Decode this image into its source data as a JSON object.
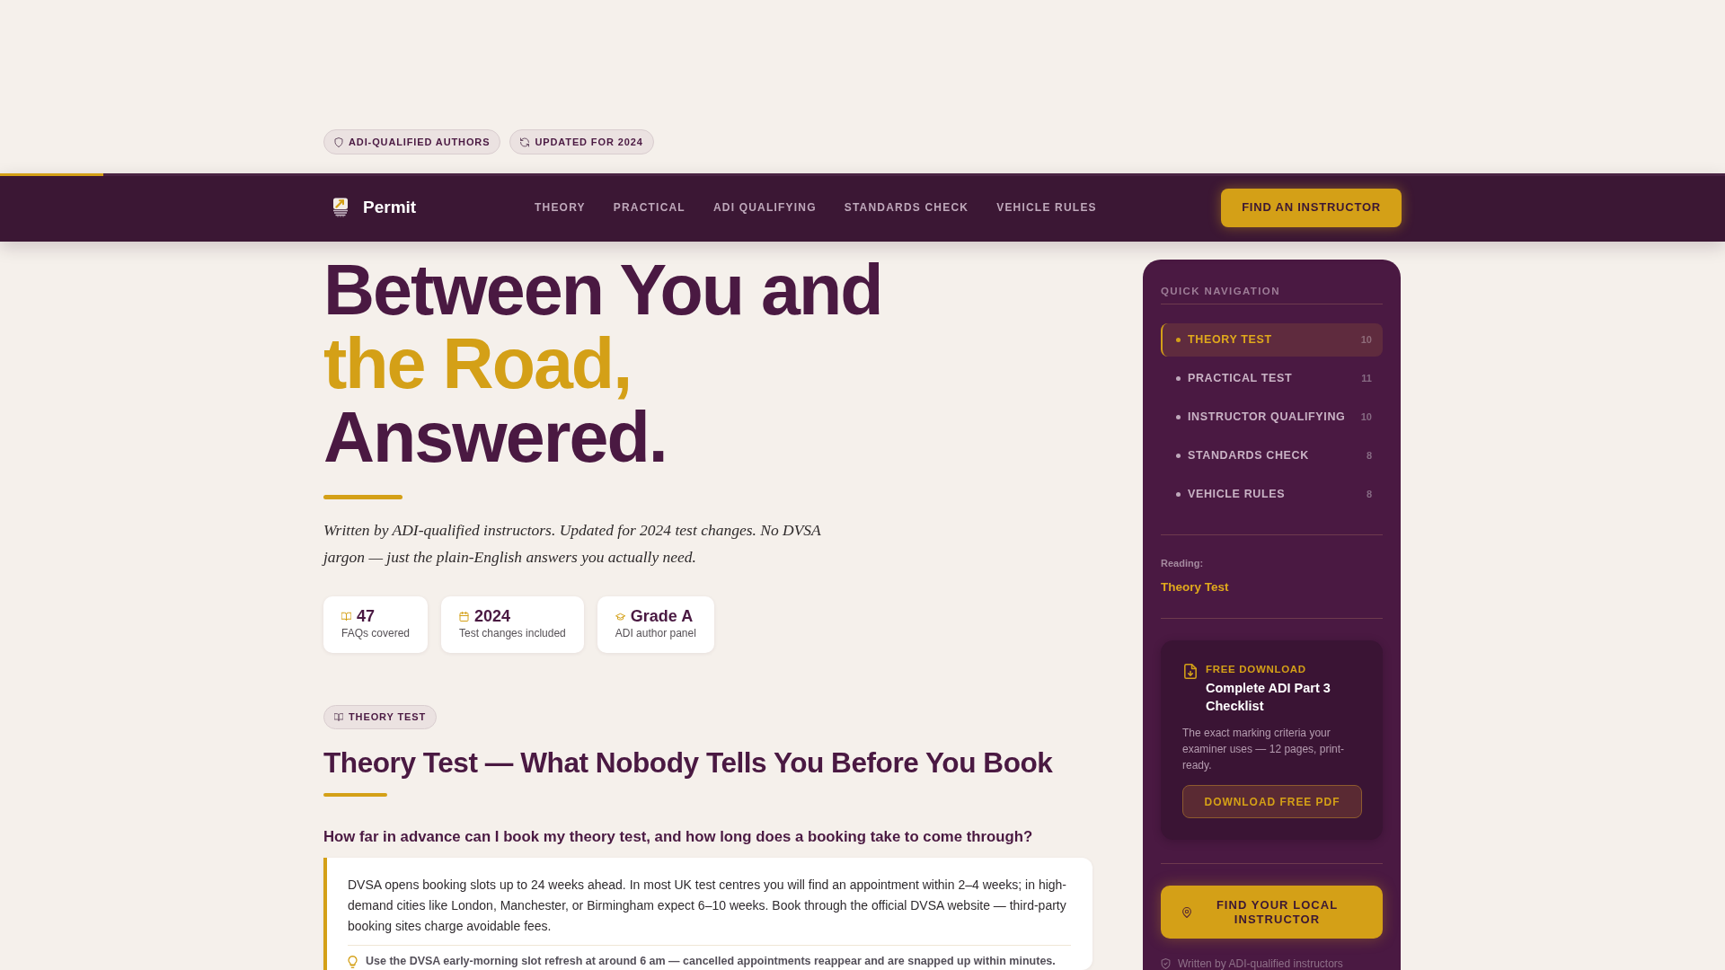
{
  "top_badges": [
    "ADI-QUALIFIED AUTHORS",
    "UPDATED FOR 2024"
  ],
  "reading_progress": {
    "level": 0.06
  },
  "navbar": {
    "brand": "Permit",
    "links": [
      "THEORY",
      "PRACTICAL",
      "ADI QUALIFYING",
      "STANDARDS CHECK",
      "VEHICLE RULES"
    ],
    "cta": "FIND AN INSTRUCTOR"
  },
  "hero": {
    "title_lines": [
      {
        "text": "Between You and",
        "highlight": false
      },
      {
        "text": "the Road,",
        "highlight": true
      },
      {
        "text": "Answered.",
        "highlight": false
      }
    ],
    "subtitle": "Written by ADI-qualified instructors. Updated for 2024 test changes. No DVSA jargon — just the plain-English answers you actually need.",
    "stats": [
      {
        "value": "47",
        "label": "FAQs covered"
      },
      {
        "value": "2024",
        "label": "Test changes included"
      },
      {
        "value": "Grade A",
        "label": "ADI author panel"
      }
    ]
  },
  "section": {
    "badge": "THEORY TEST",
    "title": "Theory Test — What Nobody Tells You Before You Book",
    "faqs": [
      {
        "question": "How far in advance can I book my theory test, and how long does a booking take to come through?",
        "answer": "DVSA opens booking slots up to 24 weeks ahead. In most UK test centres you will find an appointment within 2–4 weeks; in high-demand cities like London, Manchester, or Birmingham expect 6–10 weeks. Book through the official DVSA website — third-party booking sites charge avoidable fees.",
        "tip": "Use the DVSA early-morning slot refresh at around 6 am — cancelled appointments reappear and are snapped up within minutes."
      }
    ]
  },
  "sidebar": {
    "heading": "QUICK NAVIGATION",
    "items": [
      {
        "label": "THEORY TEST",
        "count": "10",
        "selected": true
      },
      {
        "label": "PRACTICAL TEST",
        "count": "11",
        "selected": false
      },
      {
        "label": "INSTRUCTOR QUALIFYING",
        "count": "10",
        "selected": false
      },
      {
        "label": "STANDARDS CHECK",
        "count": "8",
        "selected": false
      },
      {
        "label": "VEHICLE RULES",
        "count": "8",
        "selected": false
      }
    ],
    "reading_label": "Reading:",
    "reading_value": "Theory Test",
    "download": {
      "eyebrow": "FREE DOWNLOAD",
      "title": "Complete ADI Part 3 Checklist",
      "description": "The exact marking criteria your examiner uses — 12 pages, print-ready.",
      "button": "DOWNLOAD FREE PDF"
    },
    "cta": "FIND YOUR LOCAL INSTRUCTOR",
    "footnote": "Written by ADI-qualified instructors"
  }
}
